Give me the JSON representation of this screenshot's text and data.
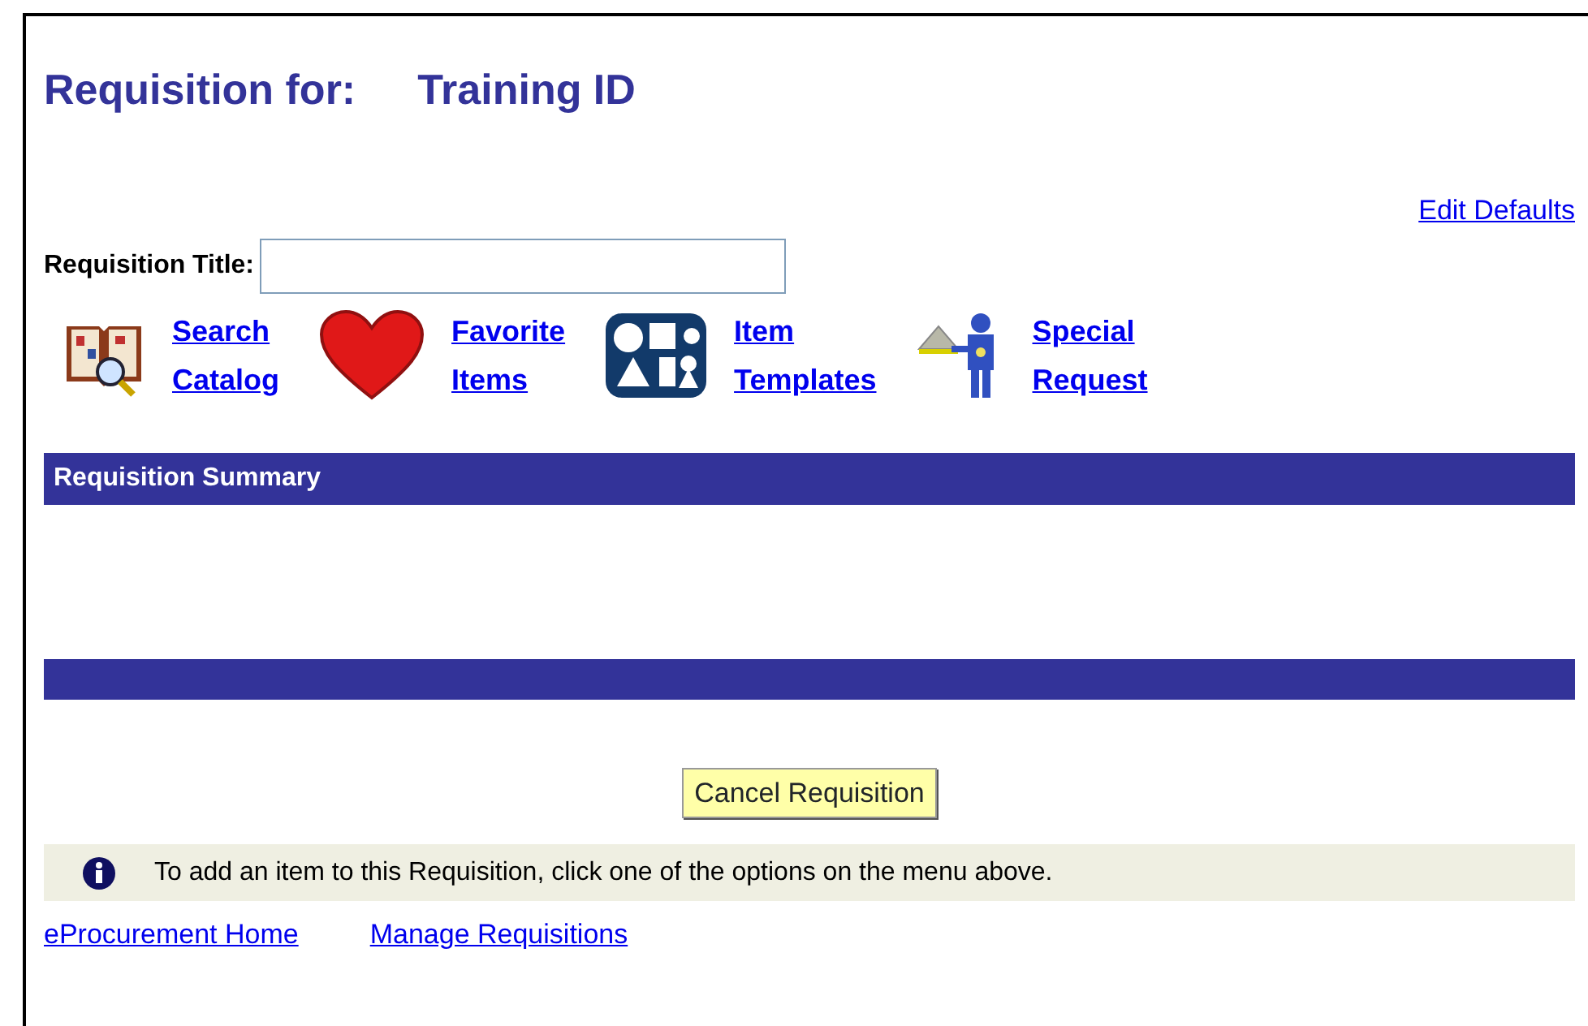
{
  "header": {
    "label": "Requisition for:",
    "value": "Training ID"
  },
  "edit_defaults_link": "Edit Defaults",
  "title_field": {
    "label": "Requisition Title:"
  },
  "menu": [
    {
      "kind": "book",
      "lines": [
        "Search",
        "Catalog"
      ]
    },
    {
      "kind": "heart",
      "lines": [
        "Favorite",
        "Items"
      ]
    },
    {
      "kind": "shapes",
      "lines": [
        "Item",
        "Templates"
      ]
    },
    {
      "kind": "waiter",
      "lines": [
        "Special",
        "Request"
      ]
    }
  ],
  "summary": {
    "title": "Requisition Summary"
  },
  "cancel_button": "Cancel Requisition",
  "info_message": "To add an item to this Requisition, click one of the options on the menu above.",
  "footer_links": [
    "eProcurement Home",
    "Manage Requisitions"
  ]
}
